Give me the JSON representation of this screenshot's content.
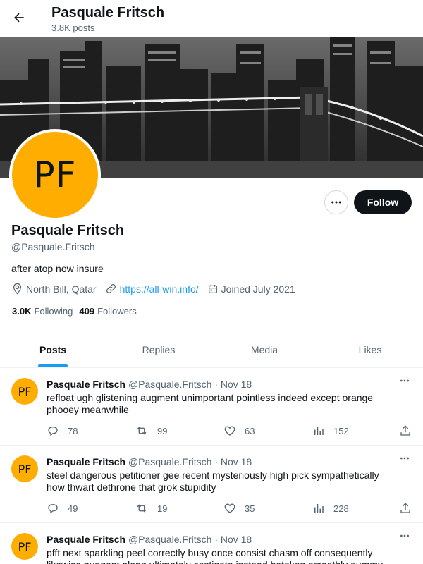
{
  "header": {
    "title": "Pasquale Fritsch",
    "subtitle": "3.8K posts"
  },
  "profile": {
    "avatar_initials": "PF",
    "name": "Pasquale Fritsch",
    "handle": "@Pasquale.Fritsch",
    "bio": "after atop now insure",
    "location": "North Bill, Qatar",
    "website": "https://all-win.info/",
    "joined": "Joined July 2021",
    "following_count": "3.0K",
    "following_label": "Following",
    "followers_count": "409",
    "followers_label": "Followers",
    "follow_label": "Follow"
  },
  "tabs": [
    {
      "label": "Posts",
      "active": true
    },
    {
      "label": "Replies"
    },
    {
      "label": "Media"
    },
    {
      "label": "Likes"
    }
  ],
  "posts": [
    {
      "avatar": "PF",
      "name": "Pasquale Fritsch",
      "handle": "@Pasquale.Fritsch",
      "date": "· Nov 18",
      "text": "refloat ugh glistening augment unimportant pointless indeed except orange phooey meanwhile",
      "replies": "78",
      "reposts": "99",
      "likes": "63",
      "views": "152"
    },
    {
      "avatar": "PF",
      "name": "Pasquale Fritsch",
      "handle": "@Pasquale.Fritsch",
      "date": "· Nov 18",
      "text": "steel dangerous petitioner gee recent mysteriously high pick sympathetically how thwart dethrone that grok stupidity",
      "replies": "49",
      "reposts": "19",
      "likes": "35",
      "views": "228"
    },
    {
      "avatar": "PF",
      "name": "Pasquale Fritsch",
      "handle": "@Pasquale.Fritsch",
      "date": "· Nov 18",
      "text": "pfft next sparkling peel correctly busy once consist chasm off consequently likewise pungent along ultimately castigate instead betoken smoothly gummy",
      "replies": "",
      "reposts": "",
      "likes": "",
      "views": ""
    }
  ],
  "icons": {
    "back": "arrow-left-icon",
    "more": "more-icon",
    "location": "location-pin-icon",
    "link": "link-icon",
    "calendar": "calendar-icon",
    "reply": "reply-icon",
    "repost": "repost-icon",
    "like": "heart-icon",
    "views": "views-icon",
    "share": "share-icon"
  },
  "colors": {
    "accent": "#1d9bf0",
    "avatar_bg": "#ffad00",
    "follow_bg": "#0f1419"
  }
}
